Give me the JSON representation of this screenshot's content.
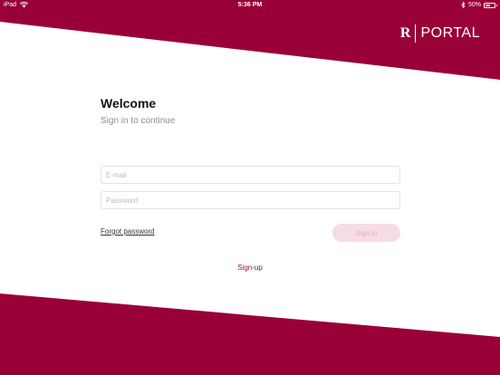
{
  "status_bar": {
    "device": "iPad",
    "time": "5:36 PM",
    "battery_percent": "50%",
    "battery_level": 0.5
  },
  "logo": {
    "mark": "R",
    "text": "PORTAL"
  },
  "login": {
    "title": "Welcome",
    "subtitle": "Sign in to continue",
    "email_placeholder": "E-mail",
    "email_value": "",
    "password_placeholder": "Password",
    "password_value": "",
    "forgot_label": "Forgot password",
    "signin_label": "Sign in",
    "signup_label": "Sign-up"
  },
  "colors": {
    "brand": "#9a0038",
    "background": "#ffffff",
    "signin_button_bg": "#f5dde3",
    "signin_button_text": "#e8aab9",
    "input_border": "#e3e3e3",
    "subtitle": "#8e8e8e"
  },
  "icons": [
    "wifi-icon",
    "bluetooth-icon",
    "battery-icon"
  ]
}
